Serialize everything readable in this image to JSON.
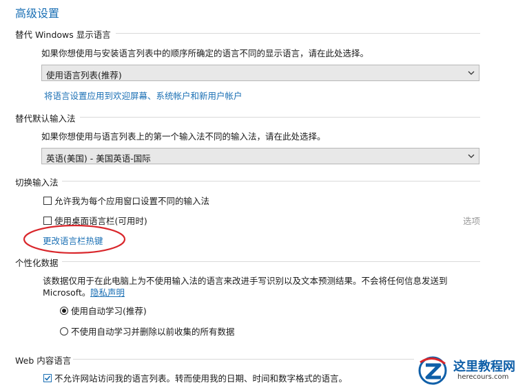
{
  "page": {
    "title": "高级设置"
  },
  "display_language": {
    "heading": "替代 Windows 显示语言",
    "description": "如果你想使用与安装语言列表中的顺序所确定的语言不同的显示语言，请在此处选择。",
    "select_value": "使用语言列表(推荐)",
    "apply_link": "将语言设置应用到欢迎屏幕、系统帐户和新用户帐户"
  },
  "input_method": {
    "heading": "替代默认输入法",
    "description": "如果你想使用与语言列表上的第一个输入法不同的输入法，请在此处选择。",
    "select_value": "英语(美国) - 美国英语-国际"
  },
  "switch_input": {
    "heading": "切换输入法",
    "checkbox_per_app": {
      "label": "允许我为每个应用窗口设置不同的输入法",
      "checked": false
    },
    "checkbox_langbar": {
      "label": "使用桌面语言栏(可用时)",
      "checked": false
    },
    "options_label": "选项",
    "hotkeys_link": "更改语言栏热键"
  },
  "personalization": {
    "heading": "个性化数据",
    "description_line1": "该数据仅用于在此电脑上为不使用输入法的语言来改进手写识别以及文本预测结果。不会将任何信息发送到",
    "description_line2": "Microsoft。",
    "privacy_link": "隐私声明",
    "radio_auto": {
      "label": "使用自动学习(推荐)",
      "selected": true
    },
    "radio_no_auto": {
      "label": "不使用自动学习并删除以前收集的所有数据",
      "selected": false
    }
  },
  "web_language": {
    "heading": "Web 内容语言",
    "checkbox_label": "不允许网站访问我的语言列表。转而使用我的日期、时间和数字格式的语言。",
    "checked": true
  },
  "watermark": {
    "text_cn": "这里教程网",
    "text_url": "herecours.com"
  },
  "colors": {
    "accent": "#1a6fb4",
    "annotation_red": "#d9262b"
  }
}
